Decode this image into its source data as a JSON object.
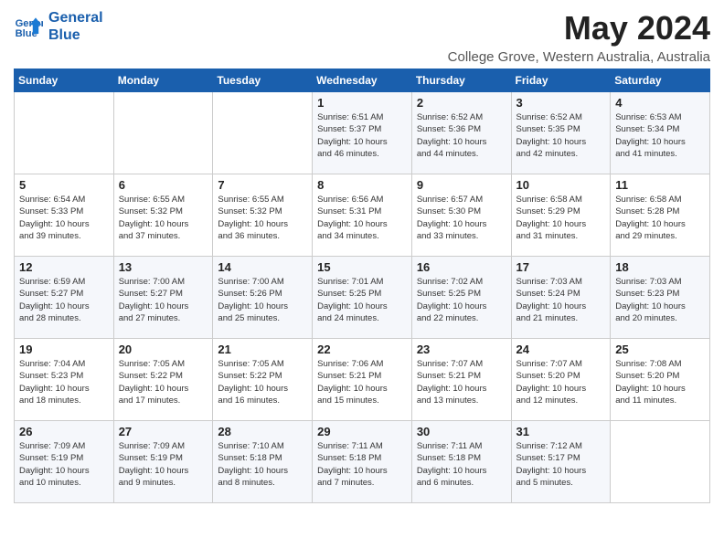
{
  "header": {
    "logo_line1": "General",
    "logo_line2": "Blue",
    "month": "May 2024",
    "location": "College Grove, Western Australia, Australia"
  },
  "days_of_week": [
    "Sunday",
    "Monday",
    "Tuesday",
    "Wednesday",
    "Thursday",
    "Friday",
    "Saturday"
  ],
  "weeks": [
    [
      {
        "day": "",
        "info": ""
      },
      {
        "day": "",
        "info": ""
      },
      {
        "day": "",
        "info": ""
      },
      {
        "day": "1",
        "info": "Sunrise: 6:51 AM\nSunset: 5:37 PM\nDaylight: 10 hours\nand 46 minutes."
      },
      {
        "day": "2",
        "info": "Sunrise: 6:52 AM\nSunset: 5:36 PM\nDaylight: 10 hours\nand 44 minutes."
      },
      {
        "day": "3",
        "info": "Sunrise: 6:52 AM\nSunset: 5:35 PM\nDaylight: 10 hours\nand 42 minutes."
      },
      {
        "day": "4",
        "info": "Sunrise: 6:53 AM\nSunset: 5:34 PM\nDaylight: 10 hours\nand 41 minutes."
      }
    ],
    [
      {
        "day": "5",
        "info": "Sunrise: 6:54 AM\nSunset: 5:33 PM\nDaylight: 10 hours\nand 39 minutes."
      },
      {
        "day": "6",
        "info": "Sunrise: 6:55 AM\nSunset: 5:32 PM\nDaylight: 10 hours\nand 37 minutes."
      },
      {
        "day": "7",
        "info": "Sunrise: 6:55 AM\nSunset: 5:32 PM\nDaylight: 10 hours\nand 36 minutes."
      },
      {
        "day": "8",
        "info": "Sunrise: 6:56 AM\nSunset: 5:31 PM\nDaylight: 10 hours\nand 34 minutes."
      },
      {
        "day": "9",
        "info": "Sunrise: 6:57 AM\nSunset: 5:30 PM\nDaylight: 10 hours\nand 33 minutes."
      },
      {
        "day": "10",
        "info": "Sunrise: 6:58 AM\nSunset: 5:29 PM\nDaylight: 10 hours\nand 31 minutes."
      },
      {
        "day": "11",
        "info": "Sunrise: 6:58 AM\nSunset: 5:28 PM\nDaylight: 10 hours\nand 29 minutes."
      }
    ],
    [
      {
        "day": "12",
        "info": "Sunrise: 6:59 AM\nSunset: 5:27 PM\nDaylight: 10 hours\nand 28 minutes."
      },
      {
        "day": "13",
        "info": "Sunrise: 7:00 AM\nSunset: 5:27 PM\nDaylight: 10 hours\nand 27 minutes."
      },
      {
        "day": "14",
        "info": "Sunrise: 7:00 AM\nSunset: 5:26 PM\nDaylight: 10 hours\nand 25 minutes."
      },
      {
        "day": "15",
        "info": "Sunrise: 7:01 AM\nSunset: 5:25 PM\nDaylight: 10 hours\nand 24 minutes."
      },
      {
        "day": "16",
        "info": "Sunrise: 7:02 AM\nSunset: 5:25 PM\nDaylight: 10 hours\nand 22 minutes."
      },
      {
        "day": "17",
        "info": "Sunrise: 7:03 AM\nSunset: 5:24 PM\nDaylight: 10 hours\nand 21 minutes."
      },
      {
        "day": "18",
        "info": "Sunrise: 7:03 AM\nSunset: 5:23 PM\nDaylight: 10 hours\nand 20 minutes."
      }
    ],
    [
      {
        "day": "19",
        "info": "Sunrise: 7:04 AM\nSunset: 5:23 PM\nDaylight: 10 hours\nand 18 minutes."
      },
      {
        "day": "20",
        "info": "Sunrise: 7:05 AM\nSunset: 5:22 PM\nDaylight: 10 hours\nand 17 minutes."
      },
      {
        "day": "21",
        "info": "Sunrise: 7:05 AM\nSunset: 5:22 PM\nDaylight: 10 hours\nand 16 minutes."
      },
      {
        "day": "22",
        "info": "Sunrise: 7:06 AM\nSunset: 5:21 PM\nDaylight: 10 hours\nand 15 minutes."
      },
      {
        "day": "23",
        "info": "Sunrise: 7:07 AM\nSunset: 5:21 PM\nDaylight: 10 hours\nand 13 minutes."
      },
      {
        "day": "24",
        "info": "Sunrise: 7:07 AM\nSunset: 5:20 PM\nDaylight: 10 hours\nand 12 minutes."
      },
      {
        "day": "25",
        "info": "Sunrise: 7:08 AM\nSunset: 5:20 PM\nDaylight: 10 hours\nand 11 minutes."
      }
    ],
    [
      {
        "day": "26",
        "info": "Sunrise: 7:09 AM\nSunset: 5:19 PM\nDaylight: 10 hours\nand 10 minutes."
      },
      {
        "day": "27",
        "info": "Sunrise: 7:09 AM\nSunset: 5:19 PM\nDaylight: 10 hours\nand 9 minutes."
      },
      {
        "day": "28",
        "info": "Sunrise: 7:10 AM\nSunset: 5:18 PM\nDaylight: 10 hours\nand 8 minutes."
      },
      {
        "day": "29",
        "info": "Sunrise: 7:11 AM\nSunset: 5:18 PM\nDaylight: 10 hours\nand 7 minutes."
      },
      {
        "day": "30",
        "info": "Sunrise: 7:11 AM\nSunset: 5:18 PM\nDaylight: 10 hours\nand 6 minutes."
      },
      {
        "day": "31",
        "info": "Sunrise: 7:12 AM\nSunset: 5:17 PM\nDaylight: 10 hours\nand 5 minutes."
      },
      {
        "day": "",
        "info": ""
      }
    ]
  ]
}
